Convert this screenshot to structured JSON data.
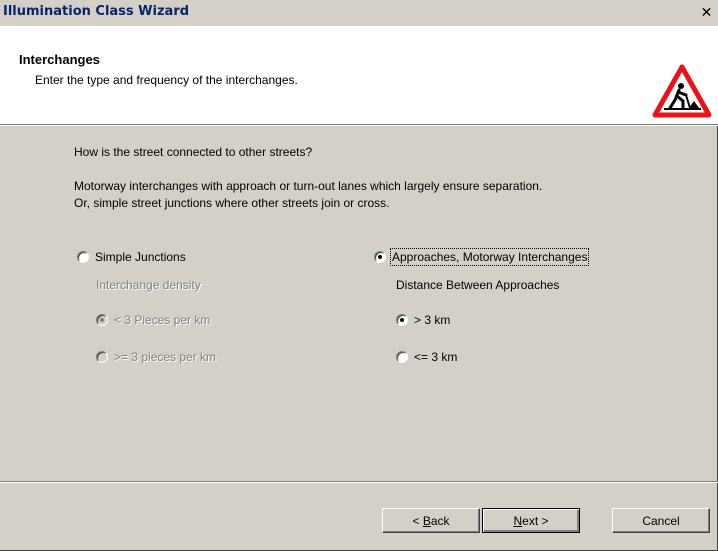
{
  "window": {
    "title": "Illumination Class Wizard",
    "close_symbol": "✕"
  },
  "header": {
    "title": "Interchanges",
    "subtitle": "Enter the type and frequency of the interchanges.",
    "icon": "roadworks-warning-icon"
  },
  "content": {
    "question": "How is the street connected to other streets?",
    "description_line1": "Motorway interchanges with approach or turn-out lanes which largely ensure separation.",
    "description_line2": "Or, simple street junctions where other streets join or cross.",
    "left": {
      "option_label": "Simple Junctions",
      "selected": false,
      "group_label": "Interchange density",
      "sub_options": [
        {
          "label": "< 3 Pieces per km",
          "selected": true,
          "enabled": false
        },
        {
          "label": ">= 3 pieces per km",
          "selected": false,
          "enabled": false
        }
      ]
    },
    "right": {
      "option_label": "Approaches, Motorway Interchanges",
      "selected": true,
      "group_label": "Distance Between Approaches",
      "sub_options": [
        {
          "label": "> 3 km",
          "selected": true,
          "enabled": true
        },
        {
          "label": "<= 3 km",
          "selected": false,
          "enabled": true
        }
      ]
    }
  },
  "buttons": {
    "back_prefix": "< ",
    "back_mnemonic": "B",
    "back_rest": "ack",
    "next_mnemonic": "N",
    "next_rest": "ext >",
    "cancel": "Cancel"
  },
  "colors": {
    "title_text": "#0a246a",
    "dialog_face": "#d4d0c8",
    "disabled_text": "#808080"
  }
}
